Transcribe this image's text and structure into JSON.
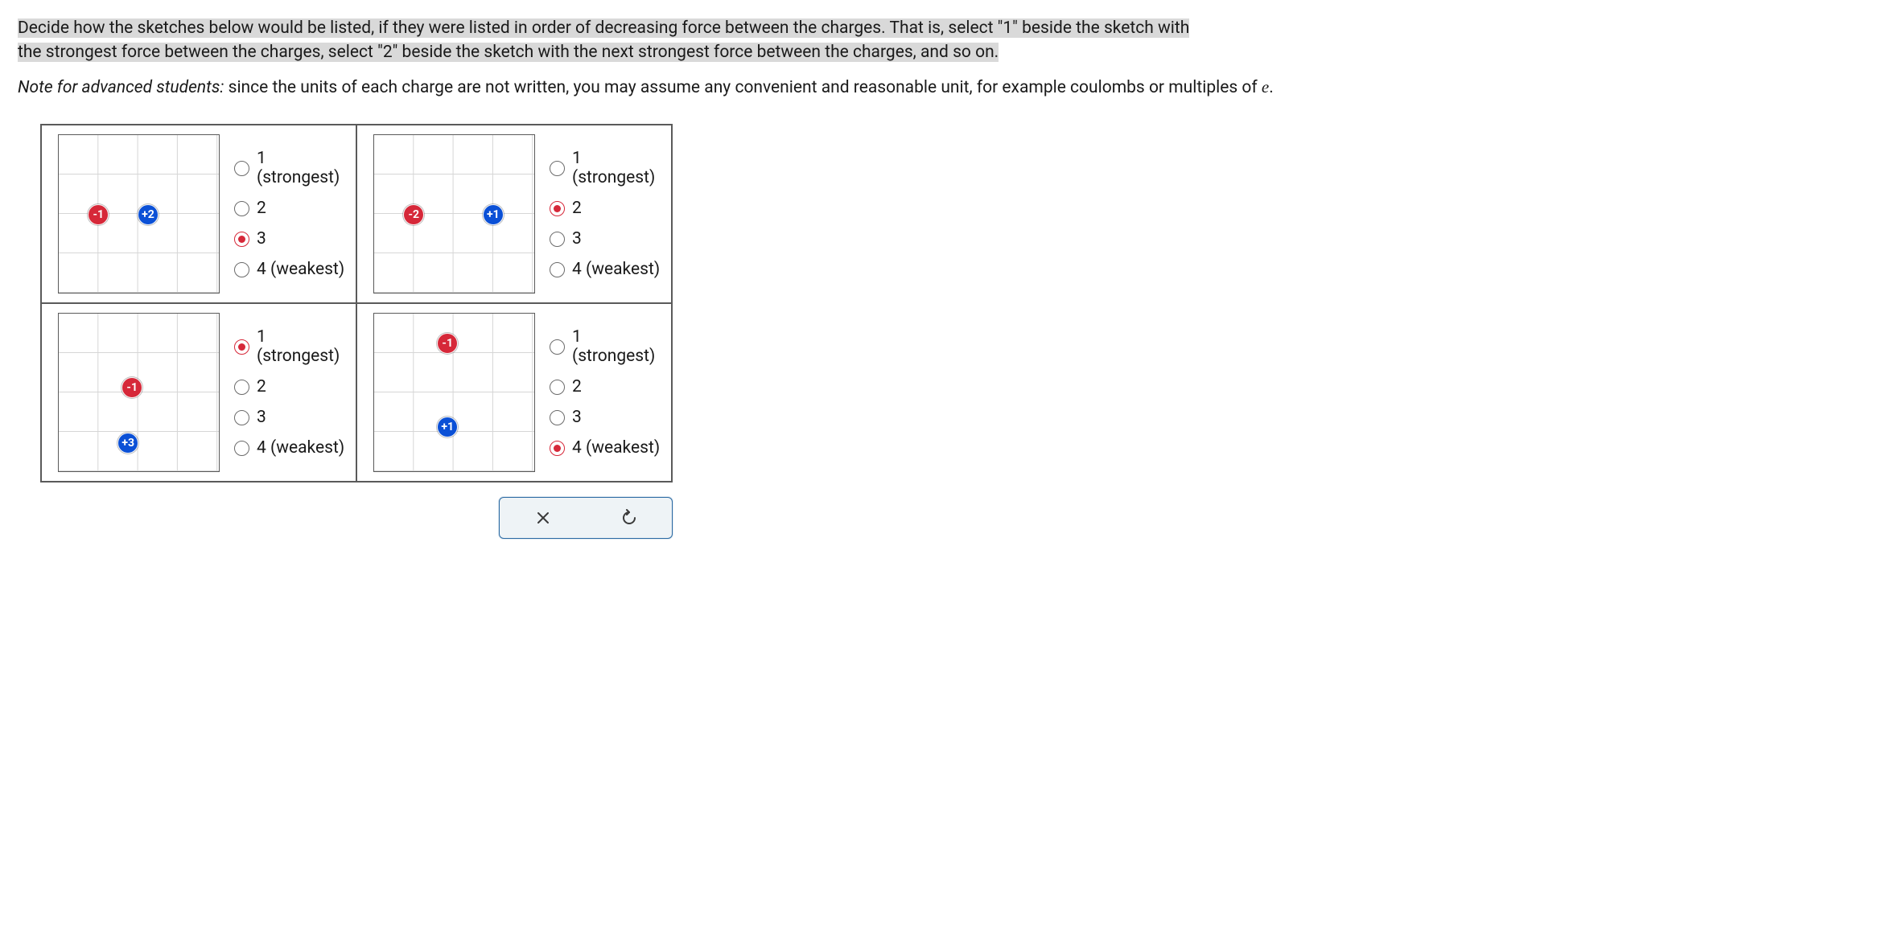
{
  "instructions": {
    "hl1": "Decide how the sketches below would be listed, if they were listed in order of decreasing force between the charges. That is, select \"1\" beside the sketch with ",
    "hl2": "the strongest force between the charges, select \"2\" beside the sketch with the next strongest force between the charges, and so on."
  },
  "note": {
    "italic": "Note for advanced students:",
    "rest_a": " since the units of each charge are not written, you may assume any convenient and reasonable unit, for example coulombs or multiples of ",
    "e": "e",
    "rest_b": "."
  },
  "option_labels": {
    "o1": "1 (strongest)",
    "o2": "2",
    "o3": "3",
    "o4": "4 (weakest)"
  },
  "cells": [
    {
      "charges": [
        {
          "label": "-1",
          "sign": "neg",
          "gx": 1,
          "gy": 2
        },
        {
          "label": "+2",
          "sign": "pos",
          "gx": 2.25,
          "gy": 2
        }
      ],
      "selected": 2
    },
    {
      "charges": [
        {
          "label": "-2",
          "sign": "neg",
          "gx": 1,
          "gy": 2
        },
        {
          "label": "+1",
          "sign": "pos",
          "gx": 3,
          "gy": 2
        }
      ],
      "selected": 1
    },
    {
      "charges": [
        {
          "label": "-1",
          "sign": "neg",
          "gx": 1.85,
          "gy": 1.85
        },
        {
          "label": "+3",
          "sign": "pos",
          "gx": 1.75,
          "gy": 3.25
        }
      ],
      "selected": 0
    },
    {
      "charges": [
        {
          "label": "-1",
          "sign": "neg",
          "gx": 1.85,
          "gy": 0.75
        },
        {
          "label": "+1",
          "sign": "pos",
          "gx": 1.85,
          "gy": 2.85
        }
      ],
      "selected": 3
    }
  ],
  "actions": {
    "close": "close",
    "reset": "reset"
  }
}
